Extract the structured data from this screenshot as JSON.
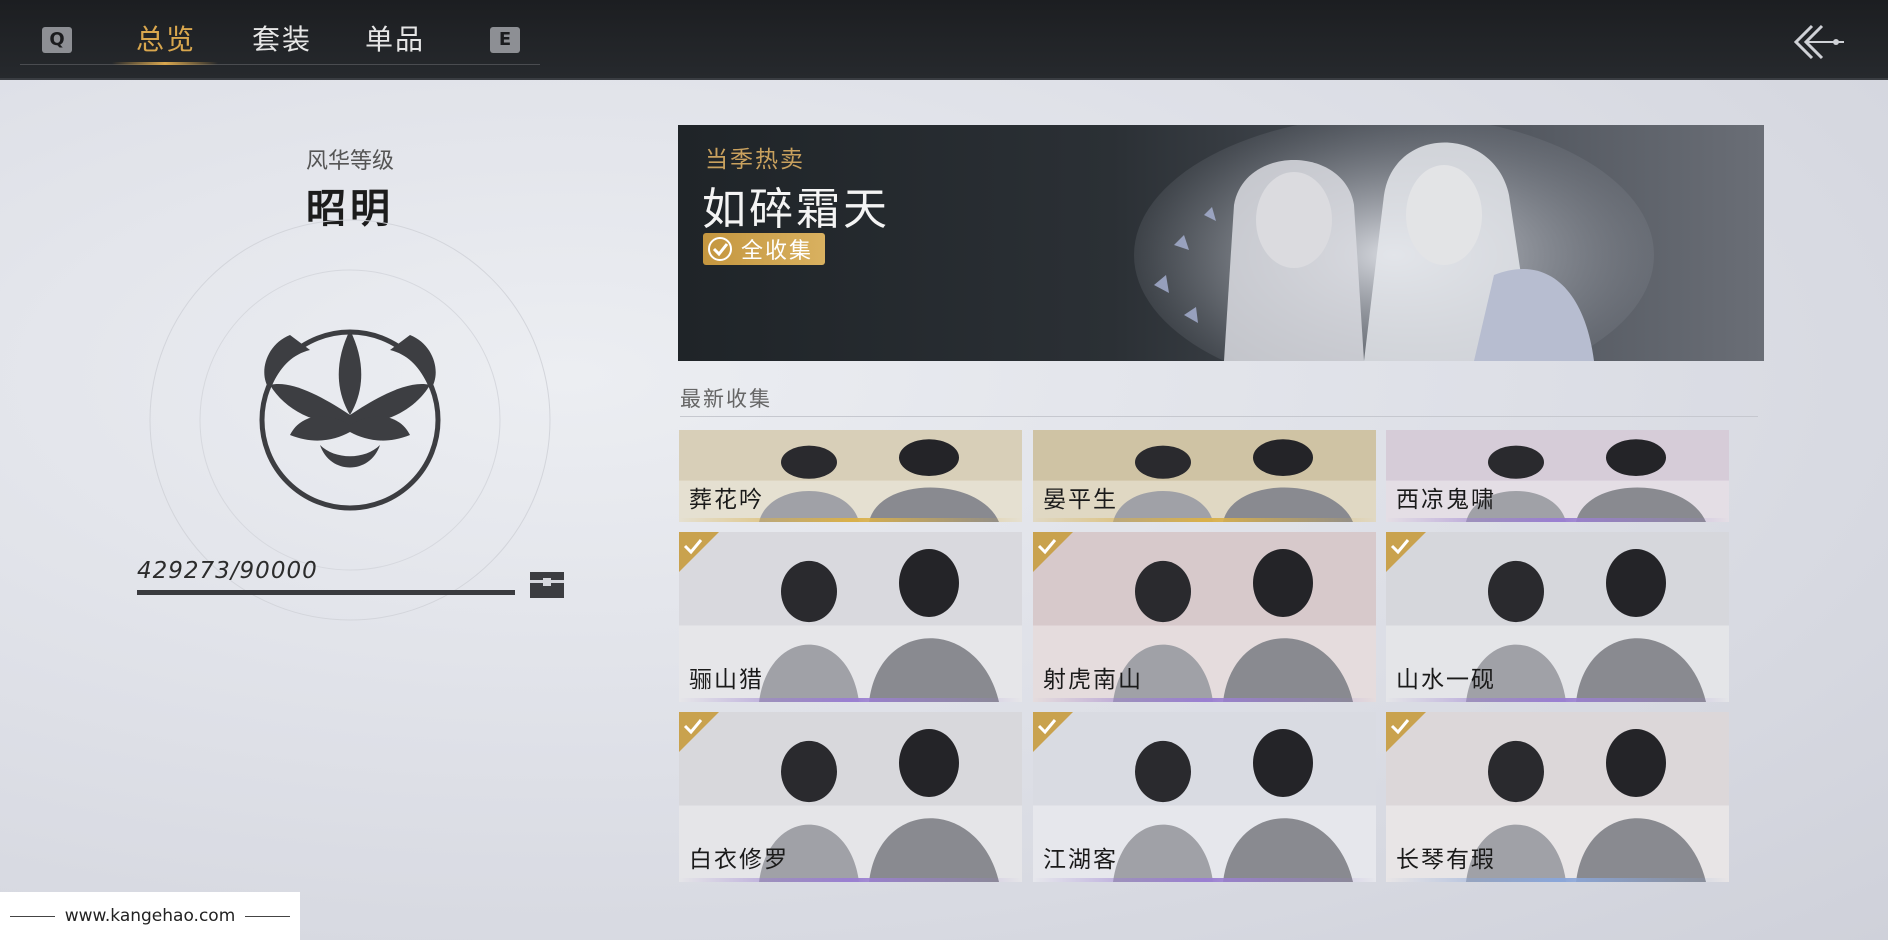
{
  "nav": {
    "key_left": "Q",
    "key_right": "E",
    "tabs": [
      {
        "label": "总览",
        "active": true
      },
      {
        "label": "套装",
        "active": false
      },
      {
        "label": "单品",
        "active": false
      }
    ],
    "back_icon": "back-arrow-icon"
  },
  "rank": {
    "label": "风华等级",
    "name": "昭明",
    "emblem_icon": "lotus-emblem-icon",
    "score": "429273/90000",
    "progress_fraction": 1.0,
    "reward_icon": "treasure-chest-icon"
  },
  "banner": {
    "tag": "当季热卖",
    "title": "如碎霜天",
    "badge": "全收集"
  },
  "recent": {
    "title": "最新收集",
    "items": [
      {
        "label": "葬花吟",
        "owned": false,
        "accent": "#d9b04a",
        "tone": "#d8cfb8"
      },
      {
        "label": "晏平生",
        "owned": false,
        "accent": "#d9b04a",
        "tone": "#cfc3a4"
      },
      {
        "label": "西凉鬼啸",
        "owned": false,
        "accent": "#9a7fd1",
        "tone": "#d6ccd8"
      },
      {
        "label": "骊山猎",
        "owned": true,
        "accent": "#9a7fd1",
        "tone": "#d9d9de"
      },
      {
        "label": "射虎南山",
        "owned": true,
        "accent": "#9a7fd1",
        "tone": "#d7c9cb"
      },
      {
        "label": "山水一砚",
        "owned": true,
        "accent": "#9a7fd1",
        "tone": "#d6d7dc"
      },
      {
        "label": "白衣修罗",
        "owned": true,
        "accent": "#9a7fd1",
        "tone": "#d8d8dc"
      },
      {
        "label": "江湖客",
        "owned": true,
        "accent": "#9a7fd1",
        "tone": "#d9dbe2"
      },
      {
        "label": "长琴有瑕",
        "owned": true,
        "accent": "#8aa6d9",
        "tone": "#dcd7d9"
      }
    ]
  },
  "watermark": "www.kangehao.com"
}
